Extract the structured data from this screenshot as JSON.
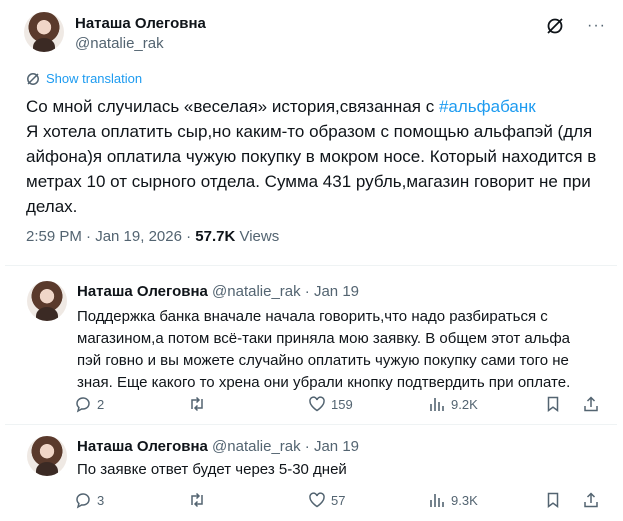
{
  "tweet": {
    "author_name": "Наташа Олеговна",
    "handle": "@natalie_rak",
    "show_translation": "Show translation",
    "line1_prefix": "Со мной случилась «веселая» история,связанная с ",
    "hashtag": "#альфабанк",
    "line2": " Я хотела оплатить сыр,но каким-то образом с помощью альфапэй (для айфона)я оплатила чужую покупку в мокром носе. Который находится в метрах 10 от сырного отдела. Сумма 431 рубль,магазин говорит не при делах.",
    "time": "2:59 PM · Jan 19, 2026 · ",
    "views": "57.7K",
    "views_label": " Views"
  },
  "replies": [
    {
      "author_name": "Наташа Олеговна",
      "handle_date": " @natalie_rak · Jan 19",
      "text": "Поддержка банка вначале начала говорить,что надо разбираться с магазином,а потом всё-таки приняла мою заявку. В общем этот альфа пэй говно и вы можете случайно оплатить чужую покупку сами того не зная. Еще какого то хрена они убрали кнопку подтвердить при оплате.",
      "replies": "2",
      "retweets": "",
      "likes": "159",
      "views": "9.2K"
    },
    {
      "author_name": "Наташа Олеговна",
      "handle_date": " @natalie_rak · Jan 19",
      "text": "По заявке ответ будет через 5-30 дней",
      "replies": "3",
      "retweets": "",
      "likes": "57",
      "views": "9.3K"
    }
  ]
}
